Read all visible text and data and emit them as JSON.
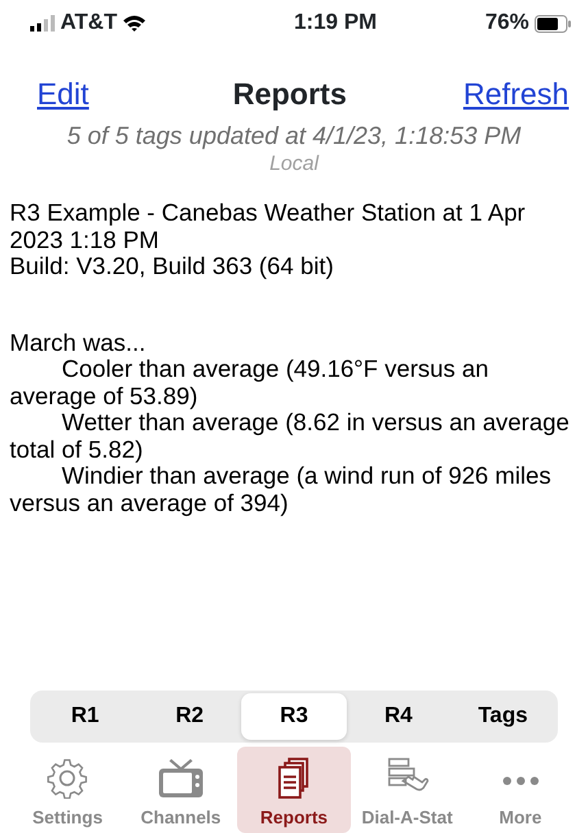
{
  "status_bar": {
    "carrier": "AT&T",
    "time": "1:19 PM",
    "battery": "76%"
  },
  "nav": {
    "left": "Edit",
    "title": "Reports",
    "right": "Refresh"
  },
  "subtitle": "5 of 5 tags updated at 4/1/23, 1:18:53 PM",
  "timezone": "Local",
  "report": [
    {
      "kind": "plain",
      "text": "R3 Example - Canebas Weather Station at 1 Apr 2023 1:18 PM"
    },
    {
      "kind": "plain",
      "text": "Build: V3.20, Build 363 (64 bit)"
    },
    {
      "kind": "section",
      "text": "March was..."
    },
    {
      "kind": "indented",
      "text": "Cooler than average (49.16°F versus an average of 53.89)"
    },
    {
      "kind": "indented",
      "text": "Wetter than average (8.62 in versus an average total of 5.82)"
    },
    {
      "kind": "indented",
      "text": "Windier than average (a wind run of 926 miles versus an average of 394)"
    }
  ],
  "segments": [
    {
      "label": "R1",
      "selected": false
    },
    {
      "label": "R2",
      "selected": false
    },
    {
      "label": "R3",
      "selected": true
    },
    {
      "label": "R4",
      "selected": false
    },
    {
      "label": "Tags",
      "selected": false
    }
  ],
  "tab_bar": [
    {
      "label": "Settings",
      "selected": false
    },
    {
      "label": "Channels",
      "selected": false
    },
    {
      "label": "Reports",
      "selected": true
    },
    {
      "label": "Dial-A-Stat",
      "selected": false
    },
    {
      "label": "More",
      "selected": false
    }
  ]
}
